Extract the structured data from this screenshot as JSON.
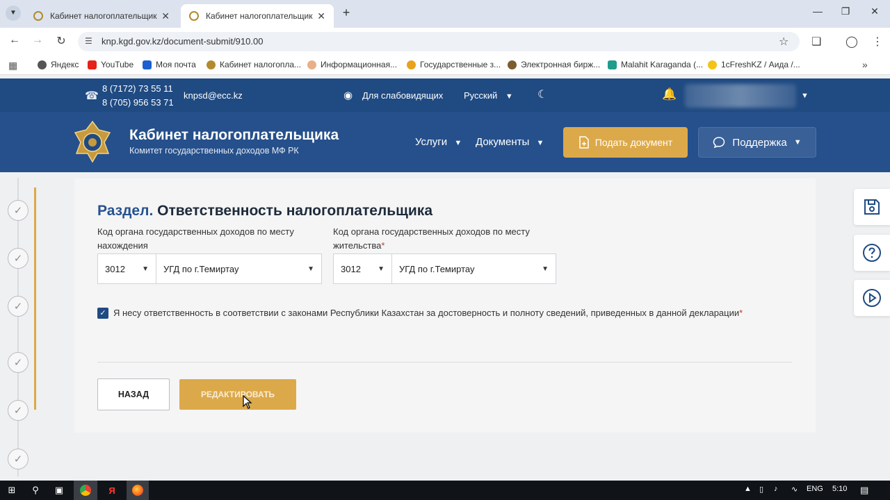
{
  "browser": {
    "tabs": [
      {
        "title": "Кабинет налогоплательщика",
        "active": false
      },
      {
        "title": "Кабинет налогоплательщика",
        "active": true
      }
    ],
    "url": "knp.kgd.gov.kz/document-submit/910.00",
    "bookmarks": [
      {
        "label": "Яндекс",
        "color": "#555"
      },
      {
        "label": "YouTube",
        "color": "#e62117"
      },
      {
        "label": "Моя почта",
        "color": "#1a5fd1"
      },
      {
        "label": "Кабинет налогопла...",
        "color": "#b38a2e"
      },
      {
        "label": "Информационная...",
        "color": "#e7b089"
      },
      {
        "label": "Государственные з...",
        "color": "#e8a21c"
      },
      {
        "label": "Электронная бирж...",
        "color": "#7a5c2e"
      },
      {
        "label": "Malahit Karaganda (...",
        "color": "#1e9c8c"
      },
      {
        "label": "1cFreshKZ / Аида /...",
        "color": "#f3c416"
      }
    ]
  },
  "site": {
    "phones": [
      "8 (7172) 73 55 11",
      "8 (705) 956 53 71"
    ],
    "email": "knpsd@ecc.kz",
    "accessibility_label": "Для слабовидящих",
    "language": "Русский",
    "title": "Кабинет налогоплательщика",
    "subtitle": "Комитет государственных доходов МФ РК",
    "menu": {
      "services": "Услуги",
      "documents": "Документы",
      "submit": "Подать документ",
      "support": "Поддержка"
    },
    "accent_color": "#dca94a",
    "brand_color": "#26508b"
  },
  "form": {
    "section_prefix": "Раздел.",
    "section_title": "Ответственность налогоплательщика",
    "location_label": "Код органа государственных доходов по месту нахождения",
    "residence_label": "Код органа государственных доходов по месту жительства",
    "required_mark": "*",
    "location_code": "3012",
    "location_name": "УГД по г.Темиртау",
    "residence_code": "3012",
    "residence_name": "УГД по г.Темиртау",
    "checkbox_checked": true,
    "checkbox_label": "Я несу ответственность в соответствии с законами Республики Казахстан за достоверность и полноту сведений, приведенных в данной декларации",
    "back_label": "НАЗАД",
    "edit_label": "РЕДАКТИРОВАТЬ"
  },
  "taskbar": {
    "language": "ENG",
    "time": "5:10"
  }
}
